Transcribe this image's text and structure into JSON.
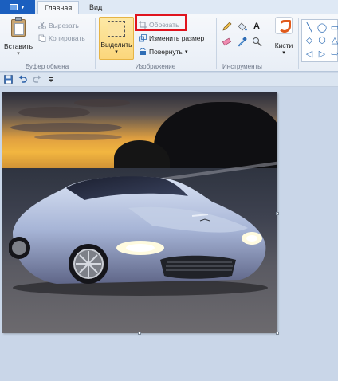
{
  "tabs": {
    "file_caret": "▼",
    "home": "Главная",
    "view": "Вид"
  },
  "clipboard": {
    "paste": "Вставить",
    "paste_caret": "▾",
    "cut": "Вырезать",
    "copy": "Копировать",
    "group_label": "Буфер обмена"
  },
  "image": {
    "select": "Выделить",
    "select_caret": "▾",
    "crop": "Обрезать",
    "resize": "Изменить размер",
    "rotate": "Повернуть",
    "rotate_caret": "▾",
    "group_label": "Изображение"
  },
  "tools": {
    "text_tool": "A",
    "group_label": "Инструменты"
  },
  "brushes": {
    "label": "Кисти",
    "caret": "▾"
  },
  "shapes": [
    "╲",
    "◯",
    "▭",
    "◇",
    "⬡",
    "△",
    "◁",
    "▷",
    "⇨"
  ],
  "colors": {
    "accent": "#1b5fbf",
    "highlight_box": "#e0141e",
    "selected_button": "#fbd67b"
  },
  "picture": {
    "subject": "car-photo"
  }
}
